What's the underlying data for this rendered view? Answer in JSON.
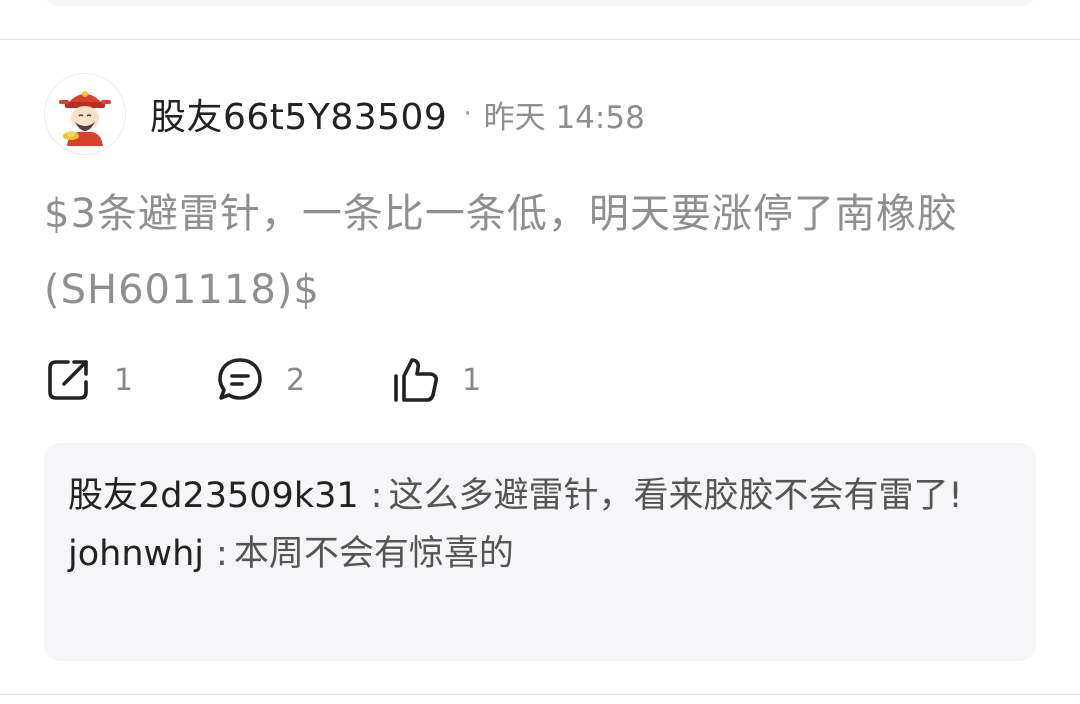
{
  "post": {
    "author": "股友66t5Y83509",
    "separator": "·",
    "time": "昨天 14:58",
    "content": "$3条避雷针，一条比一条低，明天要涨停了南橡胶(SH601118)$",
    "actions": {
      "share_count": "1",
      "comment_count": "2",
      "like_count": "1"
    }
  },
  "comments": [
    {
      "author": "股友2d23509k31",
      "colon": ":",
      "text": "这么多避雷针，看来胶胶不会有雷了!"
    },
    {
      "author": "johnwhj",
      "colon": ":",
      "text": "本周不会有惊喜的"
    }
  ],
  "icons": {
    "share": "share-icon",
    "comment": "comment-icon",
    "like": "thumbs-up-icon",
    "avatar": "caishen-avatar"
  },
  "colors": {
    "text_primary": "#222222",
    "text_secondary": "#8f8f8f",
    "comment_bg": "#f6f6f8",
    "divider": "#e4e4e6"
  }
}
